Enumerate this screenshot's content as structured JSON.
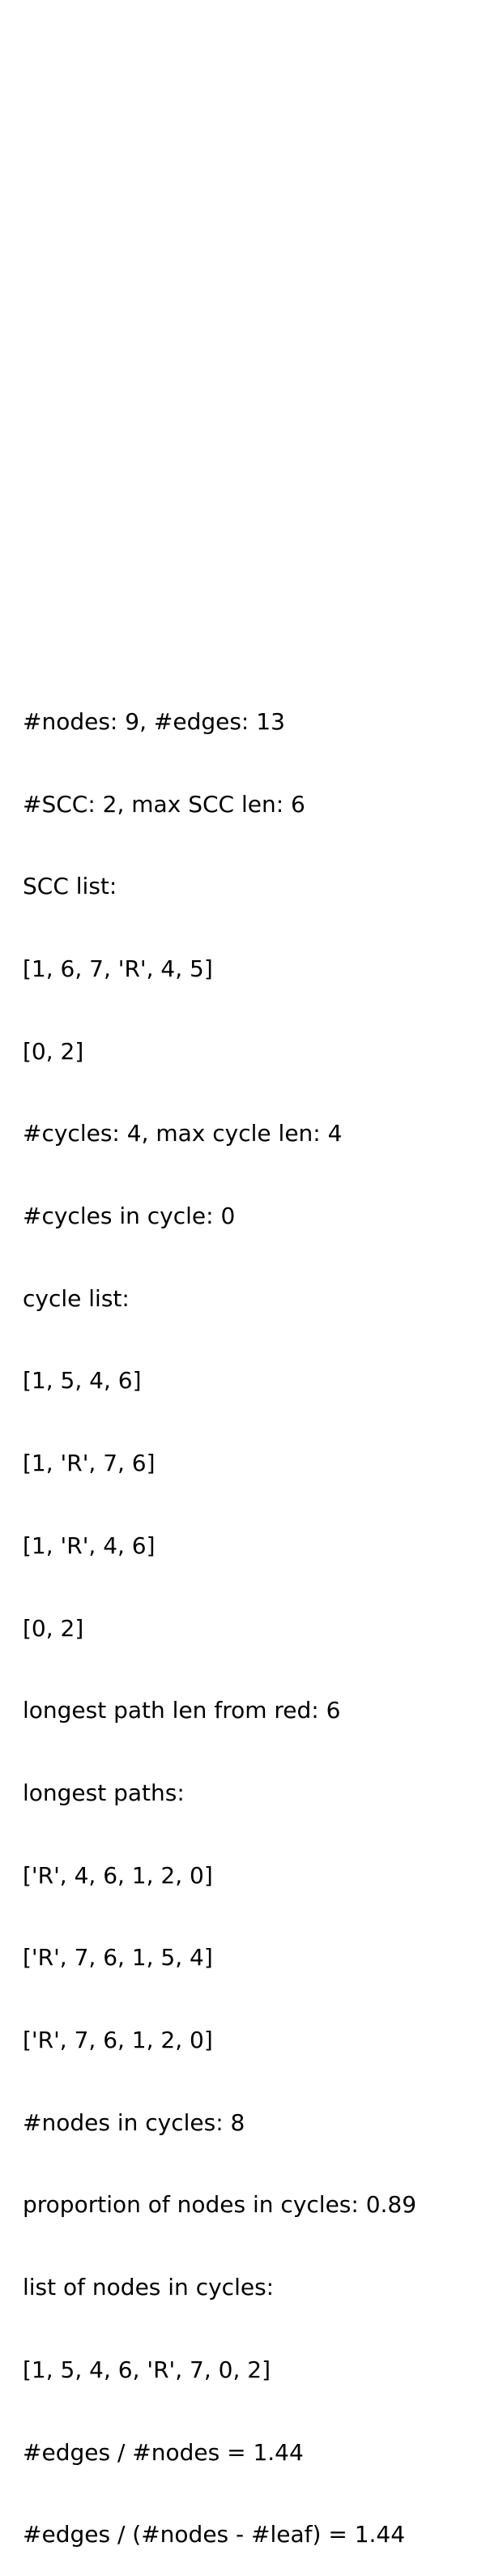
{
  "stats": {
    "lines": [
      "#nodes: 9, #edges: 13",
      "#SCC: 2, max SCC len: 6",
      "SCC list:",
      "[1, 6, 7, 'R', 4, 5]",
      "[0, 2]",
      "#cycles: 4, max cycle len: 4",
      "#cycles in cycle: 0",
      "cycle list:",
      "[1, 5, 4, 6]",
      "[1, 'R', 7, 6]",
      "[1, 'R', 4, 6]",
      "[0, 2]",
      "longest path len from red: 6",
      "longest paths:",
      "['R', 4, 6, 1, 2, 0]",
      "['R', 7, 6, 1, 5, 4]",
      "['R', 7, 6, 1, 2, 0]",
      "#nodes in cycles: 8",
      "proportion of nodes in cycles: 0.89",
      "list of nodes in cycles:",
      "[1, 5, 4, 6, 'R', 7, 0, 2]",
      "#edges / #nodes = 1.44",
      "#edges / (#nodes - #leaf) = 1.44"
    ]
  }
}
